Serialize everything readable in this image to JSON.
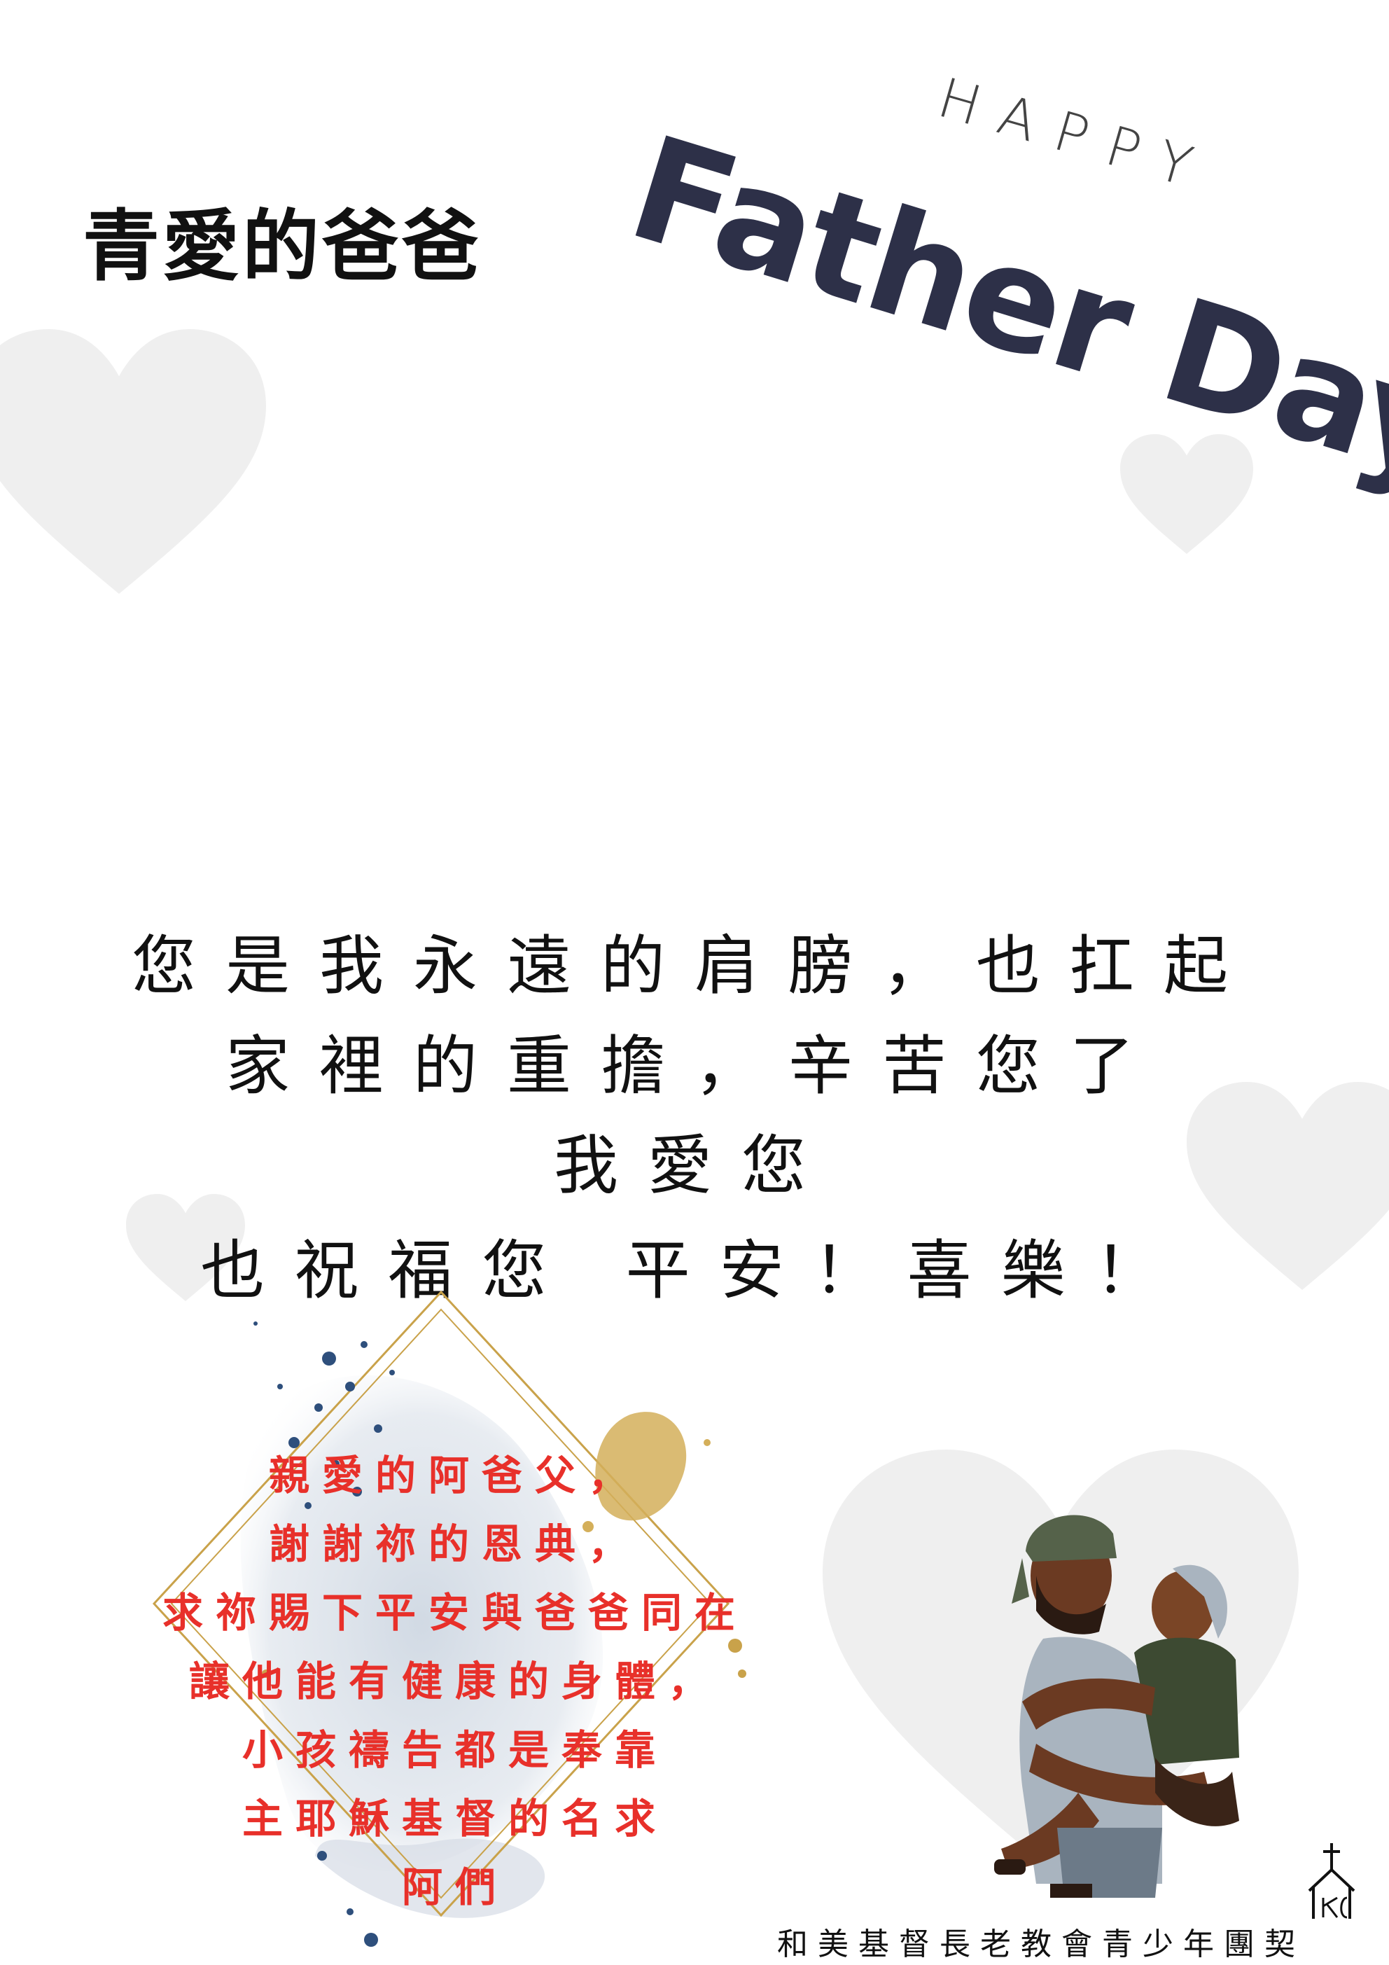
{
  "title": "青愛的爸爸",
  "happy": "HAPPY",
  "father_day": "Father Day",
  "message": {
    "line1": "您是我永遠的肩膀，也扛起",
    "line2": "家裡的重擔，辛苦您了",
    "line3": "我愛您",
    "line4": "也祝福您 平安！喜樂！"
  },
  "prayer": {
    "lines": [
      "親愛的阿爸父，",
      "謝謝祢的恩典，",
      "求祢賜下平安與爸爸同在",
      "讓他能有健康的身體，",
      "小孩禱告都是奉靠",
      "主耶穌基督的名求",
      "阿們"
    ]
  },
  "footer": "和美基督長老教會青少年團契",
  "colors": {
    "heart": "#efefef",
    "title_dark": "#2d3048",
    "prayer_red": "#e8302a",
    "gold": "#c9a24a"
  },
  "icons": [
    "heart-icon",
    "church-logo-icon",
    "father-child-illustration"
  ]
}
